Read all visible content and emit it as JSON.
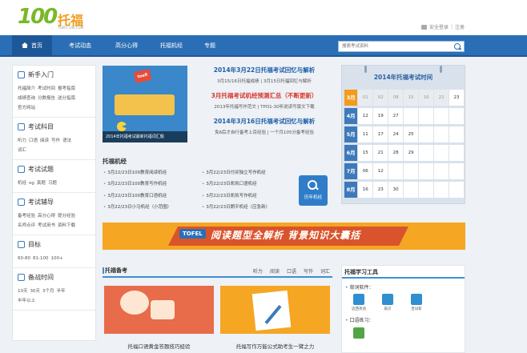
{
  "header": {
    "logo_num": "100",
    "logo_cn": "托福",
    "logo_url": "TOEFL.100.COM",
    "login": "安全登录",
    "separator": "|",
    "register": "注册"
  },
  "nav": {
    "items": [
      "首页",
      "考试动态",
      "高分心得",
      "托福机经",
      "专题"
    ],
    "search_placeholder": "搜索考试资料"
  },
  "sidebar": {
    "sections": [
      {
        "title": "新手入门",
        "icon": "book-icon",
        "lines": [
          [
            "托福简介",
            "考试时间",
            "报考指南"
          ],
          [
            "成绩查询",
            "分数报告",
            "送分指南"
          ],
          [
            "官方网站"
          ]
        ]
      },
      {
        "title": "考试科目",
        "icon": "document-icon",
        "lines": [
          [
            "听力",
            "口语",
            "阅读",
            "写作",
            "语法"
          ],
          [
            "词汇"
          ]
        ]
      },
      {
        "title": "考试试题",
        "icon": "pen-icon",
        "lines": [
          [
            "机经",
            "og",
            "真题",
            "习题"
          ]
        ]
      },
      {
        "title": "考试辅导",
        "icon": "person-icon",
        "lines": [
          [
            "备考经验",
            "高分心得",
            "提分经验"
          ],
          [
            "名师点评",
            "考试用书",
            "资料下载"
          ]
        ]
      },
      {
        "title": "目标",
        "icon": "target-icon",
        "lines": [
          [
            "60-80",
            "81-100",
            "100+"
          ]
        ]
      },
      {
        "title": "备战时间",
        "icon": "clock-icon",
        "lines": [
          [
            "10天",
            "30天",
            "3个月",
            "半年"
          ],
          [
            "半年以上"
          ]
        ]
      }
    ]
  },
  "banner": {
    "badge": "toefl",
    "caption": "2014年托福考试最新托福词汇题"
  },
  "news": [
    {
      "headline": "2014年3月22日托福考试回忆与解析",
      "sub": "3月15/16日托福成绩 | 3月15日托福回忆与解析",
      "color": "blue"
    },
    {
      "headline": "3月托福考试机经预测汇总（不断更新）",
      "sub": "2013年托福写作范文 | TPO1-30听说读写版文下载",
      "color": "red"
    },
    {
      "headline": "2014年3月16日托福考试回忆与解析",
      "sub": "免6后才自行备考上百经验 | 一个月105分备考经验",
      "color": "blue"
    }
  ],
  "jijing": {
    "title": "托福机经",
    "left": [
      "3月22/23日100教育阅读机经",
      "3月22/23日100教育写作机经",
      "3月22/23日100教育口语机经",
      "3月22/23日小马机经（小范围）"
    ],
    "right": [
      "3月22/23日付卯独立写作机经",
      "3月22/23日凯凯口语机经",
      "3月22/23日凯凯写作机经",
      "3月22/23日朗平机经（应急新）"
    ],
    "history_label": "历年机经"
  },
  "calendar": {
    "title": "2014年托福考试时间",
    "rows": [
      {
        "month": "3月",
        "highlight": true,
        "days": [
          "01",
          "02",
          "08",
          "15",
          "16",
          "22",
          "23"
        ],
        "grey": [
          0,
          1,
          2,
          3,
          4,
          5
        ]
      },
      {
        "month": "4月",
        "highlight": false,
        "days": [
          "12",
          "19",
          "27",
          "",
          "",
          "",
          ""
        ],
        "grey": []
      },
      {
        "month": "5月",
        "highlight": false,
        "days": [
          "11",
          "17",
          "24",
          "25",
          "",
          "",
          ""
        ],
        "grey": []
      },
      {
        "month": "6月",
        "highlight": false,
        "days": [
          "15",
          "21",
          "28",
          "29",
          "",
          "",
          ""
        ],
        "grey": []
      },
      {
        "month": "7月",
        "highlight": false,
        "days": [
          "06",
          "12",
          "",
          "",
          "",
          "",
          ""
        ],
        "grey": []
      },
      {
        "month": "8月",
        "highlight": false,
        "days": [
          "16",
          "23",
          "30",
          "",
          "",
          "",
          ""
        ],
        "grey": []
      }
    ]
  },
  "ad": {
    "tofel": "TOFEL",
    "text": "阅读题型全解析  背景知识大囊括"
  },
  "beikao": {
    "title": "托福备考",
    "tabs": [
      "听力",
      "阅读",
      "口语",
      "写作",
      "词汇"
    ],
    "cards": [
      "托福口语黄金答题技巧经验",
      "托福写作万能公式助考生一臂之力"
    ]
  },
  "tools": {
    "title": "托福学习工具",
    "vocab_label": "背词软件：",
    "vocab_apps": [
      "迈西英语",
      "扇贝",
      "百词斩"
    ],
    "oral_label": "口语练习："
  },
  "colors": {
    "nav": "#2a6fb6",
    "accent": "#f29b1d",
    "logo_green": "#7ab82a"
  }
}
